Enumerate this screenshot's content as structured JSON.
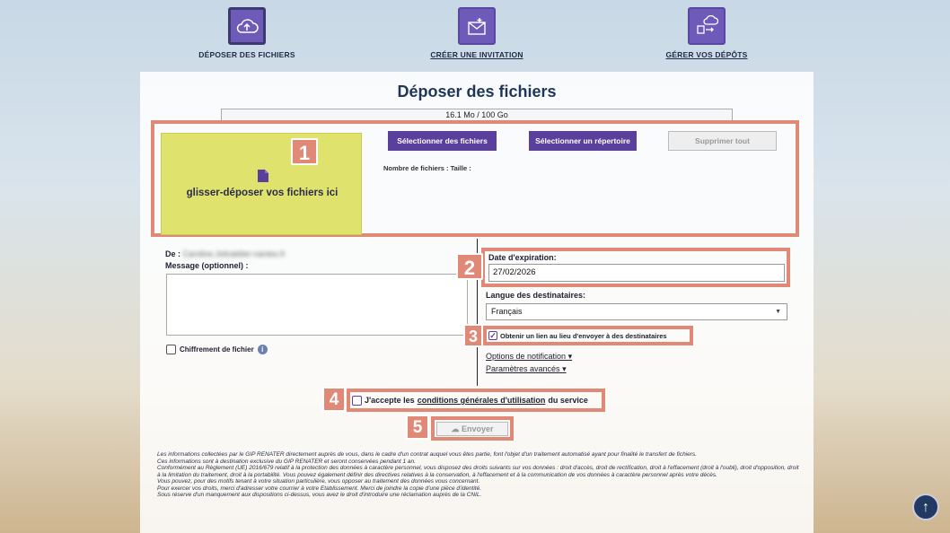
{
  "nav": {
    "items": [
      {
        "label": "DÉPOSER DES FICHIERS",
        "icon": "cloud-upload-icon"
      },
      {
        "label": "CRÉER UNE INVITATION",
        "icon": "envelope-icon"
      },
      {
        "label": "GÉRER VOS DÉPÔTS",
        "icon": "cloud-transfer-icon"
      }
    ]
  },
  "panel": {
    "title": "Déposer des fichiers",
    "quota": "16.1 Mo / 100 Go"
  },
  "upload": {
    "drop_text": "glisser-déposer vos fichiers ici",
    "select_files": "Sélectionner des fichiers",
    "select_folder": "Sélectionner un répertoire",
    "delete_all": "Supprimer tout",
    "file_info": "Nombre de fichiers : Taille :"
  },
  "form": {
    "from_label": "De :",
    "from_value": "Caroline.Jolivaldier-nantes.fr",
    "message_label": "Message (optionnel) :",
    "encryption_label": "Chiffrement de fichier",
    "expiry_label": "Date d'expiration:",
    "expiry_value": "27/02/2026",
    "lang_label": "Langue des destinataires:",
    "lang_value": "Français",
    "link_label": "Obtenir un lien au lieu d'envoyer à des destinataires",
    "notif_options": "Options de notification",
    "advanced_params": "Paramètres avancés",
    "terms_prefix": "J'accepte les",
    "terms_link": "conditions générales d'utilisation",
    "terms_suffix": "du service",
    "send": "Envoyer"
  },
  "badges": [
    "1",
    "2",
    "3",
    "4",
    "5"
  ],
  "legal": [
    "Les informations collectées par le GIP RENATER directement auprès de vous, dans le cadre d'un contrat auquel vous êtes partie, font l'objet d'un traitement automatisé ayant pour finalité le transfert de fichiers.",
    "Ces informations sont à destination exclusive du GIP RENATER et seront conservées pendant 1 an.",
    "Conformément au Règlement (UE) 2016/679 relatif à la protection des données à caractère personnel, vous disposez des droits suivants sur vos données : droit d'accès, droit de rectification, droit à l'effacement (droit à l'oubli), droit d'opposition, droit à la limitation du traitement, droit à la portabilité. Vous pouvez également définir des directives relatives à la conservation, à l'effacement et à la communication de vos données à caractère personnel après votre décès.",
    "Vous pouvez, pour des motifs tenant à votre situation particulière, vous opposer au traitement des données vous concernant.",
    "Pour exercer vos droits, merci d'adresser votre courrier à votre Etablissement. Merci de joindre la copie d'une pièce d'identité.",
    "Sous réserve d'un manquement aux dispositions ci-dessus, vous avez le droit d'introduire une réclamation auprès de la CNIL."
  ],
  "scroll_top": "↑",
  "colors": {
    "accent": "#5b3f9c",
    "highlight": "#e08976",
    "dropzone": "#dfe36e"
  }
}
